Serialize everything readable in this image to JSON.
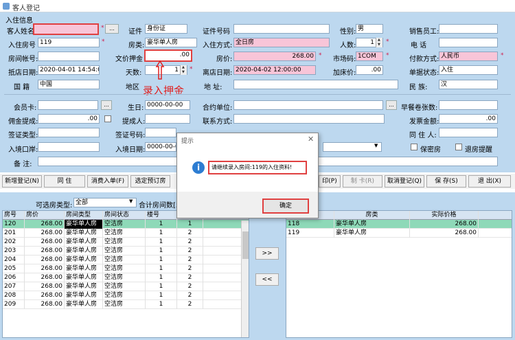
{
  "window": {
    "title": "客人登记"
  },
  "section": {
    "title": "入住信息"
  },
  "form": {
    "guest_name_label": "客人姓名",
    "guest_name": "",
    "ellipsis": "...",
    "id_type_label": "证件",
    "id_type": "身份证",
    "id_no_label": "证件号码",
    "id_no": "",
    "gender_label": "性别:",
    "gender": "男",
    "sales_label": "销售员工:",
    "sales": "",
    "room_no_label": "入住房号",
    "room_no": "119",
    "room_type_label": "房类:",
    "room_type": "豪华单人房",
    "stay_mode_label": "入住方式:",
    "stay_mode": "全日房",
    "persons_label": "人数:",
    "persons": "1",
    "phone_label": "电    话",
    "phone": "",
    "account_label": "房间帐号:",
    "account": "",
    "deposit_label": "文价押金",
    "deposit": ".00",
    "price_label": "房价:",
    "price": "268.00",
    "market_label": "市场码:",
    "market": "1COM",
    "pay_label": "付款方式:",
    "pay": "人民币",
    "arrive_label": "抵店日期:",
    "arrive": "2020-04-01 14:54:00",
    "days_label": "天数:",
    "days": "1",
    "depart_label": "离店日期:",
    "depart": "2020-04-02 12:00:00",
    "addprice_label": "加床价:",
    "addprice": ".00",
    "bill_status_label": "单据状态:",
    "bill_status": "入住",
    "nation_label": "国    籍",
    "nation": "中国",
    "region_label": "地区",
    "address_label": "地    址:",
    "ethnic_label": "民    族:",
    "ethnic": "汉",
    "member_label": "会员卡:",
    "member": "",
    "birthday_label": "生日:",
    "birthday": "0000-00-00",
    "unit_label": "合约单位:",
    "unit": "",
    "breakfast_label": "早餐卷张数:",
    "breakfast": "",
    "commission_label": "佣金提成:",
    "commission": ".00",
    "referrer_label": "提成人:",
    "referrer": "",
    "contact_label": "联系方式:",
    "contact": "",
    "invoice_label": "发票金额:",
    "invoice": ".00",
    "visa_type_label": "签证类型:",
    "visa_type": "",
    "visa_no_label": "签证号码:",
    "visa_no": "",
    "issuer_label": "签证机关:",
    "issuer": "",
    "roommate_label": "同 住 人:",
    "roommate": "",
    "port_label": "入境口岸:",
    "port": "",
    "entry_date_label": "入境日期:",
    "entry_date": "0000-00-00",
    "secret_label": "保密房",
    "checkout_remind_label": "退房提醒",
    "remark_label": "备    注:",
    "remark": ""
  },
  "annotation": {
    "text": "录入押金"
  },
  "toolbar": {
    "new": "新增登记(N)",
    "same": "同      住",
    "consume": "消费入单(F)",
    "book": "选定预订房",
    "print": "印(P)",
    "card": "制    卡(R)",
    "cancel": "取消登记(Q)",
    "save": "保    存(S)",
    "exit": "退    出(X)"
  },
  "lower": {
    "room_type_label": "可选房类型:",
    "room_type_value": "全部",
    "total_label": "合计房间数[53"
  },
  "left_table": {
    "headers": [
      "房号",
      "房价",
      "房间类型",
      "房间状态",
      "楼号",
      ""
    ],
    "rows": [
      [
        "120",
        "268.00",
        "豪华单人房",
        "空洁房",
        "1",
        "1"
      ],
      [
        "201",
        "268.00",
        "豪华单人房",
        "空洁房",
        "1",
        "2"
      ],
      [
        "202",
        "268.00",
        "豪华单人房",
        "空洁房",
        "1",
        "2"
      ],
      [
        "203",
        "268.00",
        "豪华单人房",
        "空洁房",
        "1",
        "2"
      ],
      [
        "204",
        "268.00",
        "豪华单人房",
        "空洁房",
        "1",
        "2"
      ],
      [
        "205",
        "268.00",
        "豪华单人房",
        "空洁房",
        "1",
        "2"
      ],
      [
        "206",
        "268.00",
        "豪华单人房",
        "空洁房",
        "1",
        "2"
      ],
      [
        "207",
        "268.00",
        "豪华单人房",
        "空洁房",
        "1",
        "2"
      ],
      [
        "208",
        "268.00",
        "豪华单人房",
        "空洁房",
        "1",
        "2"
      ],
      [
        "209",
        "268.00",
        "豪华单人房",
        "空洁房",
        "1",
        "2"
      ]
    ]
  },
  "right_table": {
    "headers": [
      "房号",
      "房类",
      "实际价格"
    ],
    "rows": [
      [
        "118",
        "豪华单人房",
        "268.00"
      ],
      [
        "119",
        "豪华单人房",
        "268.00"
      ]
    ]
  },
  "move": {
    "right": ">>",
    "left": "<<"
  },
  "dialog": {
    "title": "提示",
    "message": "请继续录入房间:119的入住资料!",
    "ok": "确定"
  },
  "colors": {
    "form_bg": "#bdd8ef",
    "required": "#f8c5d8",
    "selected_row": "#8ed9b8",
    "annotation": "#e02020"
  }
}
